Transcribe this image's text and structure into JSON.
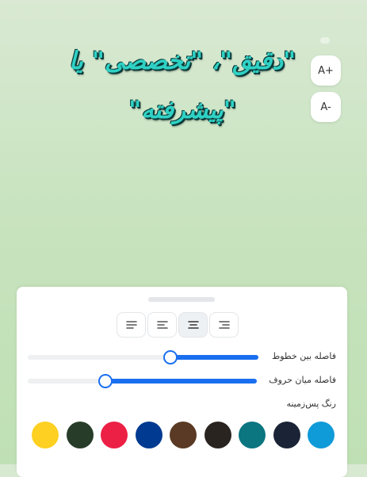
{
  "headline": {
    "line1": "\"دقیق\"، \"تخصصی\" یا",
    "line2": "\"پیشرفته\""
  },
  "font_controls": {
    "increase_label": "A+",
    "decrease_label": "A-"
  },
  "alignment": {
    "options": [
      "justify",
      "left",
      "center",
      "right"
    ],
    "selected": "center"
  },
  "sliders": {
    "line_spacing": {
      "label": "فاصله بین خطوط",
      "value": 0.38
    },
    "letter_spacing": {
      "label": "فاصله میان حروف",
      "value": 0.66
    }
  },
  "background": {
    "label": "رنگ پس‌زمینه",
    "colors": [
      "#fdd022",
      "#283d29",
      "#ec2045",
      "#013a91",
      "#5a3a24",
      "#2a2420",
      "#0b7580",
      "#1b2436",
      "#0f9ad8"
    ]
  }
}
